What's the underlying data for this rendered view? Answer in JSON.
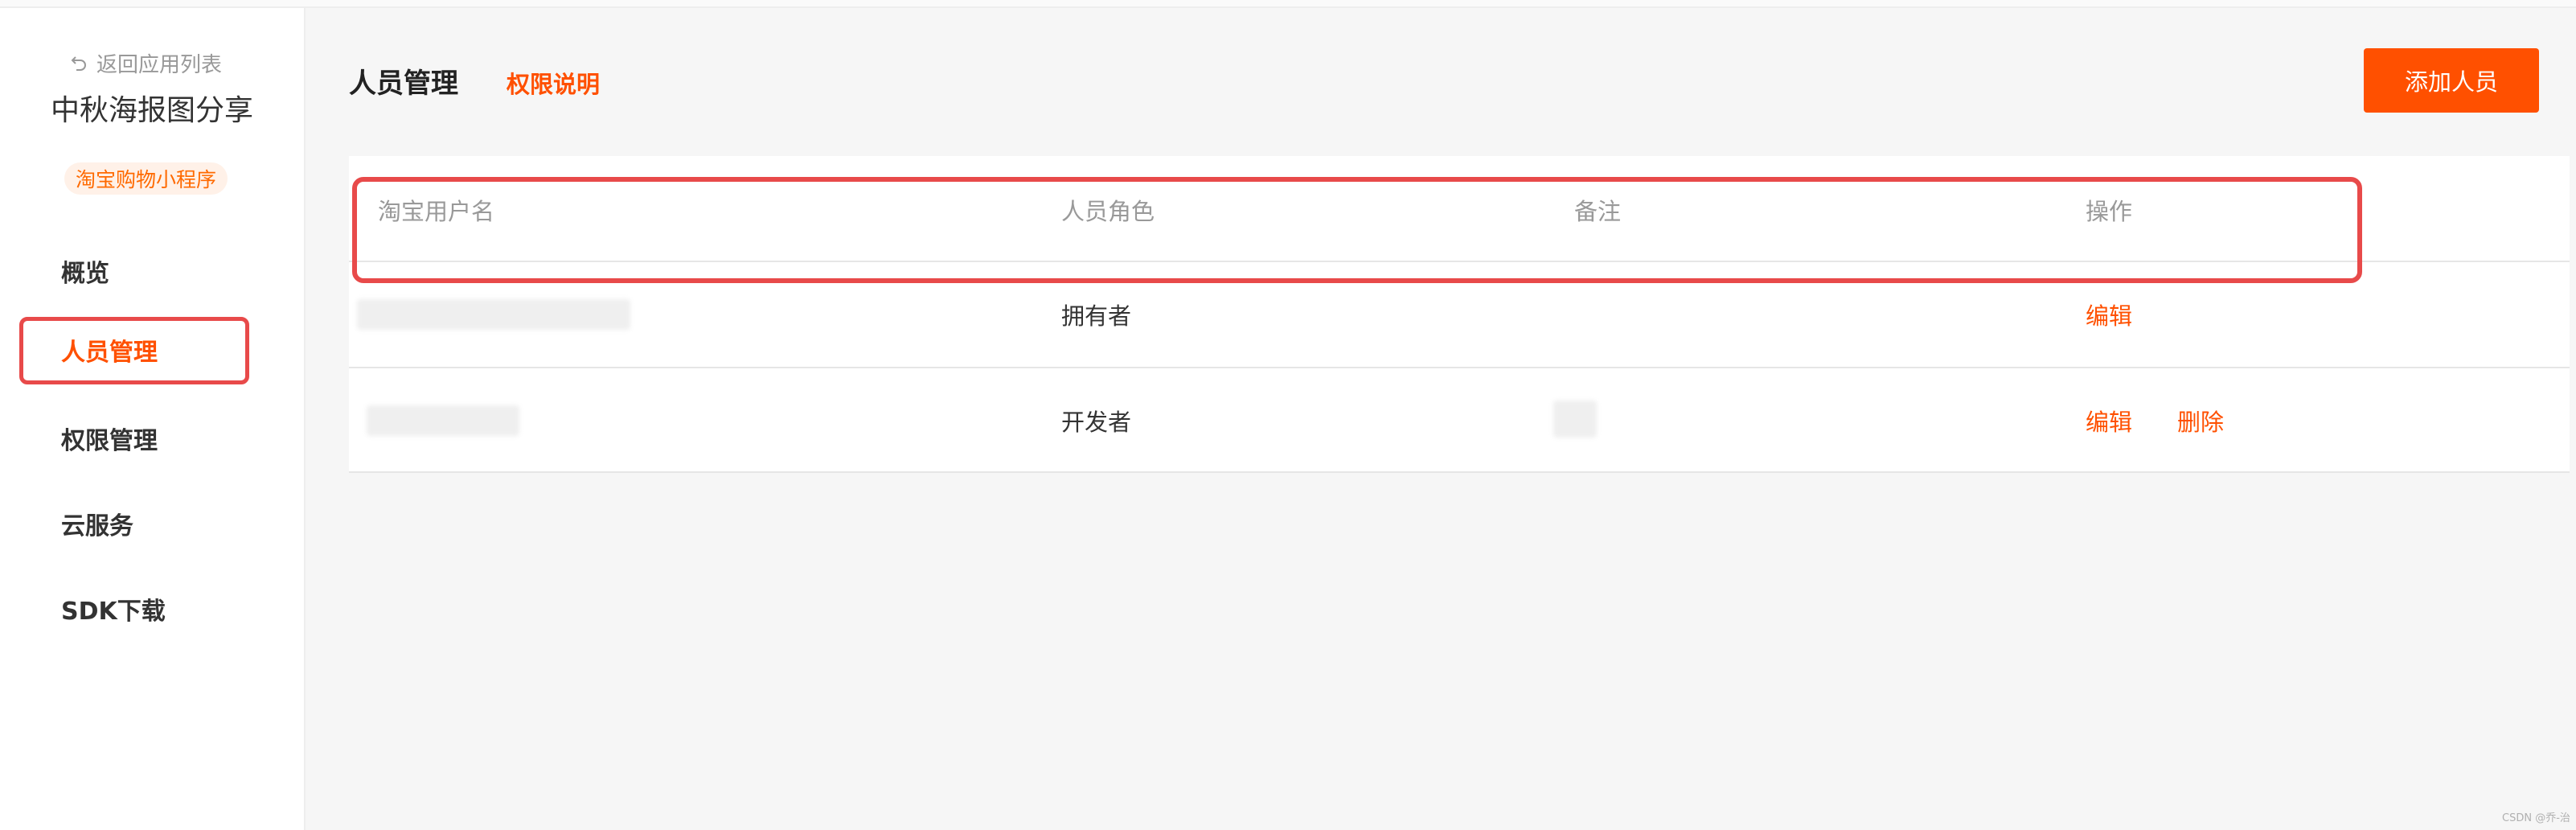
{
  "sidebar": {
    "back_label": "返回应用列表",
    "app_name": "中秋海报图分享",
    "app_badge": "淘宝购物小程序",
    "items": [
      {
        "label": "概览"
      },
      {
        "label": "人员管理",
        "active": true
      },
      {
        "label": "权限管理"
      },
      {
        "label": "云服务"
      },
      {
        "label": "SDK下载"
      }
    ]
  },
  "header": {
    "title": "人员管理",
    "perm_link": "权限说明",
    "add_button": "添加人员"
  },
  "table": {
    "columns": [
      "淘宝用户名",
      "人员角色",
      "备注",
      "操作"
    ],
    "rows": [
      {
        "username": "",
        "role": "拥有者",
        "note": "",
        "actions": [
          "编辑"
        ]
      },
      {
        "username": "",
        "role": "开发者",
        "note": "",
        "actions": [
          "编辑",
          "删除"
        ]
      }
    ]
  },
  "colors": {
    "accent": "#ff5000",
    "annotation": "#e84a4a"
  },
  "watermark": "CSDN @乔-治"
}
